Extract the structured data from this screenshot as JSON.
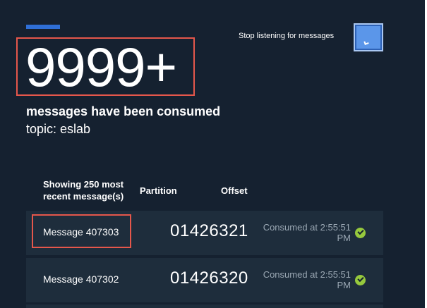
{
  "summary": {
    "count": "9999+",
    "consumed_label": "messages have been consumed",
    "topic_label": "topic: eslab"
  },
  "controls": {
    "stop_label": "Stop listening for messages"
  },
  "table": {
    "headers": {
      "messages": "Showing 250 most recent message(s)",
      "partition": "Partition",
      "offset": "Offset"
    },
    "rows": [
      {
        "message": "Message 407303",
        "partition": "",
        "offset": "01426321",
        "status": "Consumed at 2:55:51 PM",
        "status_icon": "checkmark-circle-icon"
      },
      {
        "message": "Message 407302",
        "partition": "",
        "offset": "01426320",
        "status": "Consumed at 2:55:51 PM",
        "status_icon": "checkmark-circle-icon"
      }
    ]
  },
  "colors": {
    "background": "#152130",
    "accent": "#2f6fd6",
    "highlight": "#e5574b",
    "success": "#96c93d"
  }
}
